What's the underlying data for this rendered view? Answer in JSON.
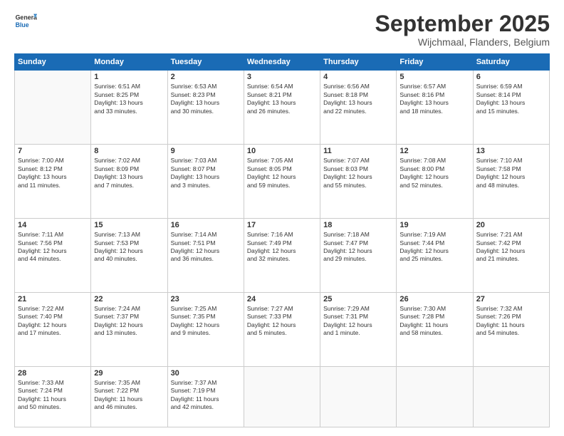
{
  "logo": {
    "general": "General",
    "blue": "Blue"
  },
  "title": "September 2025",
  "location": "Wijchmaal, Flanders, Belgium",
  "days_header": [
    "Sunday",
    "Monday",
    "Tuesday",
    "Wednesday",
    "Thursday",
    "Friday",
    "Saturday"
  ],
  "weeks": [
    [
      {
        "day": "",
        "info": ""
      },
      {
        "day": "1",
        "info": "Sunrise: 6:51 AM\nSunset: 8:25 PM\nDaylight: 13 hours\nand 33 minutes."
      },
      {
        "day": "2",
        "info": "Sunrise: 6:53 AM\nSunset: 8:23 PM\nDaylight: 13 hours\nand 30 minutes."
      },
      {
        "day": "3",
        "info": "Sunrise: 6:54 AM\nSunset: 8:21 PM\nDaylight: 13 hours\nand 26 minutes."
      },
      {
        "day": "4",
        "info": "Sunrise: 6:56 AM\nSunset: 8:18 PM\nDaylight: 13 hours\nand 22 minutes."
      },
      {
        "day": "5",
        "info": "Sunrise: 6:57 AM\nSunset: 8:16 PM\nDaylight: 13 hours\nand 18 minutes."
      },
      {
        "day": "6",
        "info": "Sunrise: 6:59 AM\nSunset: 8:14 PM\nDaylight: 13 hours\nand 15 minutes."
      }
    ],
    [
      {
        "day": "7",
        "info": "Sunrise: 7:00 AM\nSunset: 8:12 PM\nDaylight: 13 hours\nand 11 minutes."
      },
      {
        "day": "8",
        "info": "Sunrise: 7:02 AM\nSunset: 8:09 PM\nDaylight: 13 hours\nand 7 minutes."
      },
      {
        "day": "9",
        "info": "Sunrise: 7:03 AM\nSunset: 8:07 PM\nDaylight: 13 hours\nand 3 minutes."
      },
      {
        "day": "10",
        "info": "Sunrise: 7:05 AM\nSunset: 8:05 PM\nDaylight: 12 hours\nand 59 minutes."
      },
      {
        "day": "11",
        "info": "Sunrise: 7:07 AM\nSunset: 8:03 PM\nDaylight: 12 hours\nand 55 minutes."
      },
      {
        "day": "12",
        "info": "Sunrise: 7:08 AM\nSunset: 8:00 PM\nDaylight: 12 hours\nand 52 minutes."
      },
      {
        "day": "13",
        "info": "Sunrise: 7:10 AM\nSunset: 7:58 PM\nDaylight: 12 hours\nand 48 minutes."
      }
    ],
    [
      {
        "day": "14",
        "info": "Sunrise: 7:11 AM\nSunset: 7:56 PM\nDaylight: 12 hours\nand 44 minutes."
      },
      {
        "day": "15",
        "info": "Sunrise: 7:13 AM\nSunset: 7:53 PM\nDaylight: 12 hours\nand 40 minutes."
      },
      {
        "day": "16",
        "info": "Sunrise: 7:14 AM\nSunset: 7:51 PM\nDaylight: 12 hours\nand 36 minutes."
      },
      {
        "day": "17",
        "info": "Sunrise: 7:16 AM\nSunset: 7:49 PM\nDaylight: 12 hours\nand 32 minutes."
      },
      {
        "day": "18",
        "info": "Sunrise: 7:18 AM\nSunset: 7:47 PM\nDaylight: 12 hours\nand 29 minutes."
      },
      {
        "day": "19",
        "info": "Sunrise: 7:19 AM\nSunset: 7:44 PM\nDaylight: 12 hours\nand 25 minutes."
      },
      {
        "day": "20",
        "info": "Sunrise: 7:21 AM\nSunset: 7:42 PM\nDaylight: 12 hours\nand 21 minutes."
      }
    ],
    [
      {
        "day": "21",
        "info": "Sunrise: 7:22 AM\nSunset: 7:40 PM\nDaylight: 12 hours\nand 17 minutes."
      },
      {
        "day": "22",
        "info": "Sunrise: 7:24 AM\nSunset: 7:37 PM\nDaylight: 12 hours\nand 13 minutes."
      },
      {
        "day": "23",
        "info": "Sunrise: 7:25 AM\nSunset: 7:35 PM\nDaylight: 12 hours\nand 9 minutes."
      },
      {
        "day": "24",
        "info": "Sunrise: 7:27 AM\nSunset: 7:33 PM\nDaylight: 12 hours\nand 5 minutes."
      },
      {
        "day": "25",
        "info": "Sunrise: 7:29 AM\nSunset: 7:31 PM\nDaylight: 12 hours\nand 1 minute."
      },
      {
        "day": "26",
        "info": "Sunrise: 7:30 AM\nSunset: 7:28 PM\nDaylight: 11 hours\nand 58 minutes."
      },
      {
        "day": "27",
        "info": "Sunrise: 7:32 AM\nSunset: 7:26 PM\nDaylight: 11 hours\nand 54 minutes."
      }
    ],
    [
      {
        "day": "28",
        "info": "Sunrise: 7:33 AM\nSunset: 7:24 PM\nDaylight: 11 hours\nand 50 minutes."
      },
      {
        "day": "29",
        "info": "Sunrise: 7:35 AM\nSunset: 7:22 PM\nDaylight: 11 hours\nand 46 minutes."
      },
      {
        "day": "30",
        "info": "Sunrise: 7:37 AM\nSunset: 7:19 PM\nDaylight: 11 hours\nand 42 minutes."
      },
      {
        "day": "",
        "info": ""
      },
      {
        "day": "",
        "info": ""
      },
      {
        "day": "",
        "info": ""
      },
      {
        "day": "",
        "info": ""
      }
    ]
  ]
}
